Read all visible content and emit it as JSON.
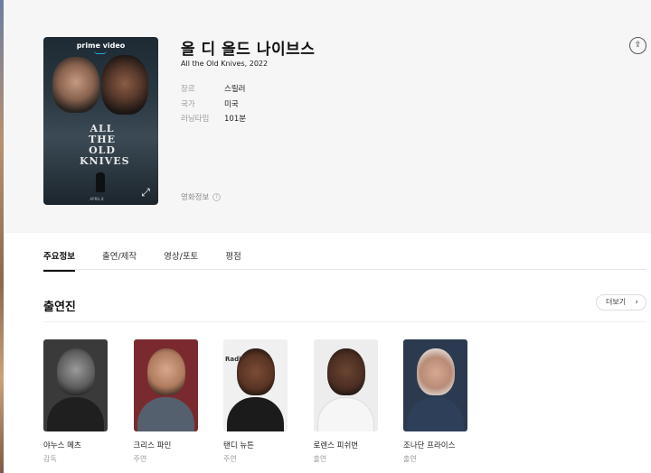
{
  "movie": {
    "title": "올 디 올드 나이브스",
    "subtitle": "All the Old Knives, 2022",
    "info": [
      {
        "label": "장르",
        "value": "스릴러"
      },
      {
        "label": "국가",
        "value": "미국"
      },
      {
        "label": "러닝타임",
        "value": "101분"
      }
    ],
    "movie_info_link": "영화정보",
    "info_dot": "!"
  },
  "poster": {
    "brand": "prime video",
    "title_art": "ALL THE OLD KNIVES",
    "bottom_text": "APRIL 8",
    "expand_icon": "⤢"
  },
  "share_icon": "⇪",
  "tabs": [
    "주요정보",
    "출연/제작",
    "영상/포토",
    "평점"
  ],
  "cast_section": {
    "title": "출연진",
    "more_label": "더보기",
    "more_chevron": "›",
    "members": [
      {
        "name": "야누스 메츠",
        "role": "감독"
      },
      {
        "name": "크리스 파인",
        "role": "주연"
      },
      {
        "name": "탠디 뉴튼",
        "role": "주연"
      },
      {
        "name": "로렌스 피쉬번",
        "role": "출연"
      },
      {
        "name": "조나단 프라이스",
        "role": "출연"
      }
    ],
    "photo_text": "Radi"
  }
}
